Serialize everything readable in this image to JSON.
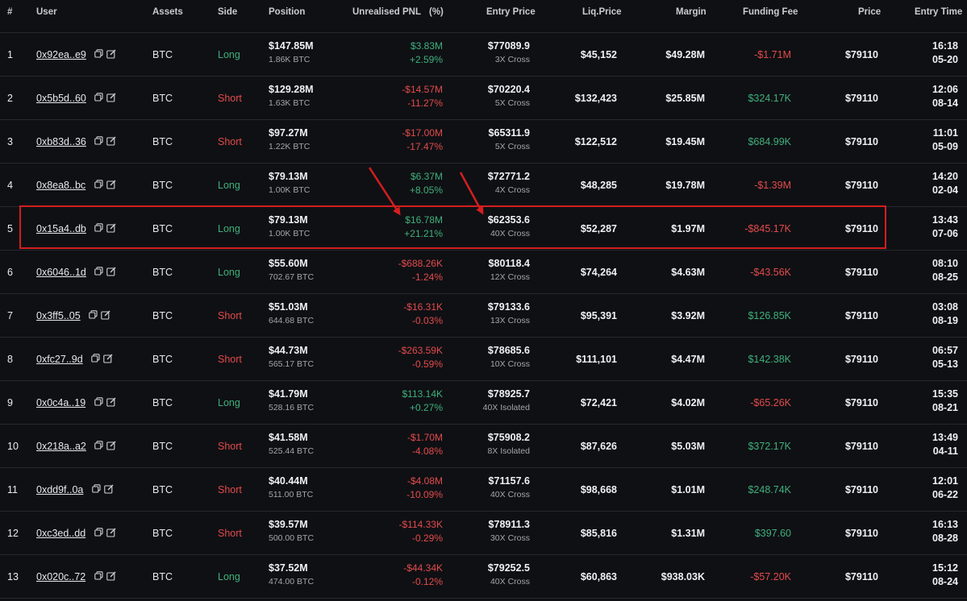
{
  "headers": {
    "rank": "#",
    "user": "User",
    "assets": "Assets",
    "side": "Side",
    "position": "Position",
    "pnl": "Unrealised PNL",
    "pct": "(%)",
    "entry": "Entry Price",
    "liq": "Liq.Price",
    "margin": "Margin",
    "funding": "Funding Fee",
    "price": "Price",
    "time": "Entry Time"
  },
  "colors": {
    "positive": "#3fb07c",
    "negative": "#e24b4b",
    "highlight": "#d41e1e"
  },
  "icons": [
    "copy-icon",
    "edit-icon"
  ],
  "rows": [
    {
      "rank": "1",
      "user": "0x92ea..e9",
      "asset": "BTC",
      "side": "Long",
      "sideType": "long",
      "position": "$147.85M",
      "positionBtc": "1.86K BTC",
      "pnl": "$3.83M",
      "pnlPct": "+2.59%",
      "pnlType": "pos",
      "entry": "$77089.9",
      "leverage": "3X Cross",
      "liq": "$45,152",
      "margin": "$49.28M",
      "funding": "-$1.71M",
      "fundingType": "neg",
      "price": "$79110",
      "time": "16:18",
      "date": "05-20"
    },
    {
      "rank": "2",
      "user": "0x5b5d..60",
      "asset": "BTC",
      "side": "Short",
      "sideType": "short",
      "position": "$129.28M",
      "positionBtc": "1.63K BTC",
      "pnl": "-$14.57M",
      "pnlPct": "-11.27%",
      "pnlType": "neg",
      "entry": "$70220.4",
      "leverage": "5X Cross",
      "liq": "$132,423",
      "margin": "$25.85M",
      "funding": "$324.17K",
      "fundingType": "pos",
      "price": "$79110",
      "time": "12:06",
      "date": "08-14"
    },
    {
      "rank": "3",
      "user": "0xb83d..36",
      "asset": "BTC",
      "side": "Short",
      "sideType": "short",
      "position": "$97.27M",
      "positionBtc": "1.22K BTC",
      "pnl": "-$17.00M",
      "pnlPct": "-17.47%",
      "pnlType": "neg",
      "entry": "$65311.9",
      "leverage": "5X Cross",
      "liq": "$122,512",
      "margin": "$19.45M",
      "funding": "$684.99K",
      "fundingType": "pos",
      "price": "$79110",
      "time": "11:01",
      "date": "05-09"
    },
    {
      "rank": "4",
      "user": "0x8ea8..bc",
      "asset": "BTC",
      "side": "Long",
      "sideType": "long",
      "position": "$79.13M",
      "positionBtc": "1.00K BTC",
      "pnl": "$6.37M",
      "pnlPct": "+8.05%",
      "pnlType": "pos",
      "entry": "$72771.2",
      "leverage": "4X Cross",
      "liq": "$48,285",
      "margin": "$19.78M",
      "funding": "-$1.39M",
      "fundingType": "neg",
      "price": "$79110",
      "time": "14:20",
      "date": "02-04"
    },
    {
      "rank": "5",
      "user": "0x15a4..db",
      "asset": "BTC",
      "side": "Long",
      "sideType": "long",
      "position": "$79.13M",
      "positionBtc": "1.00K BTC",
      "pnl": "$16.78M",
      "pnlPct": "+21.21%",
      "pnlType": "pos",
      "entry": "$62353.6",
      "leverage": "40X Cross",
      "liq": "$52,287",
      "margin": "$1.97M",
      "funding": "-$845.17K",
      "fundingType": "neg",
      "price": "$79110",
      "time": "13:43",
      "date": "07-06"
    },
    {
      "rank": "6",
      "user": "0x6046..1d",
      "asset": "BTC",
      "side": "Long",
      "sideType": "long",
      "position": "$55.60M",
      "positionBtc": "702.67 BTC",
      "pnl": "-$688.26K",
      "pnlPct": "-1.24%",
      "pnlType": "neg",
      "entry": "$80118.4",
      "leverage": "12X Cross",
      "liq": "$74,264",
      "margin": "$4.63M",
      "funding": "-$43.56K",
      "fundingType": "neg",
      "price": "$79110",
      "time": "08:10",
      "date": "08-25"
    },
    {
      "rank": "7",
      "user": "0x3ff5..05",
      "asset": "BTC",
      "side": "Short",
      "sideType": "short",
      "position": "$51.03M",
      "positionBtc": "644.68 BTC",
      "pnl": "-$16.31K",
      "pnlPct": "-0.03%",
      "pnlType": "neg",
      "entry": "$79133.6",
      "leverage": "13X Cross",
      "liq": "$95,391",
      "margin": "$3.92M",
      "funding": "$126.85K",
      "fundingType": "pos",
      "price": "$79110",
      "time": "03:08",
      "date": "08-19"
    },
    {
      "rank": "8",
      "user": "0xfc27..9d",
      "asset": "BTC",
      "side": "Short",
      "sideType": "short",
      "position": "$44.73M",
      "positionBtc": "565.17 BTC",
      "pnl": "-$263.59K",
      "pnlPct": "-0.59%",
      "pnlType": "neg",
      "entry": "$78685.6",
      "leverage": "10X Cross",
      "liq": "$111,101",
      "margin": "$4.47M",
      "funding": "$142.38K",
      "fundingType": "pos",
      "price": "$79110",
      "time": "06:57",
      "date": "05-13"
    },
    {
      "rank": "9",
      "user": "0x0c4a..19",
      "asset": "BTC",
      "side": "Long",
      "sideType": "long",
      "position": "$41.79M",
      "positionBtc": "528.16 BTC",
      "pnl": "$113.14K",
      "pnlPct": "+0.27%",
      "pnlType": "pos",
      "entry": "$78925.7",
      "leverage": "40X Isolated",
      "liq": "$72,421",
      "margin": "$4.02M",
      "funding": "-$65.26K",
      "fundingType": "neg",
      "price": "$79110",
      "time": "15:35",
      "date": "08-21"
    },
    {
      "rank": "10",
      "user": "0x218a..a2",
      "asset": "BTC",
      "side": "Short",
      "sideType": "short",
      "position": "$41.58M",
      "positionBtc": "525.44 BTC",
      "pnl": "-$1.70M",
      "pnlPct": "-4.08%",
      "pnlType": "neg",
      "entry": "$75908.2",
      "leverage": "8X Isolated",
      "liq": "$87,626",
      "margin": "$5.03M",
      "funding": "$372.17K",
      "fundingType": "pos",
      "price": "$79110",
      "time": "13:49",
      "date": "04-11"
    },
    {
      "rank": "11",
      "user": "0xdd9f..0a",
      "asset": "BTC",
      "side": "Short",
      "sideType": "short",
      "position": "$40.44M",
      "positionBtc": "511.00 BTC",
      "pnl": "-$4.08M",
      "pnlPct": "-10.09%",
      "pnlType": "neg",
      "entry": "$71157.6",
      "leverage": "40X Cross",
      "liq": "$98,668",
      "margin": "$1.01M",
      "funding": "$248.74K",
      "fundingType": "pos",
      "price": "$79110",
      "time": "12:01",
      "date": "06-22"
    },
    {
      "rank": "12",
      "user": "0xc3ed..dd",
      "asset": "BTC",
      "side": "Short",
      "sideType": "short",
      "position": "$39.57M",
      "positionBtc": "500.00 BTC",
      "pnl": "-$114.33K",
      "pnlPct": "-0.29%",
      "pnlType": "neg",
      "entry": "$78911.3",
      "leverage": "30X Cross",
      "liq": "$85,816",
      "margin": "$1.31M",
      "funding": "$397.60",
      "fundingType": "pos",
      "price": "$79110",
      "time": "16:13",
      "date": "08-28"
    },
    {
      "rank": "13",
      "user": "0x020c..72",
      "asset": "BTC",
      "side": "Long",
      "sideType": "long",
      "position": "$37.52M",
      "positionBtc": "474.00 BTC",
      "pnl": "-$44.34K",
      "pnlPct": "-0.12%",
      "pnlType": "neg",
      "entry": "$79252.5",
      "leverage": "40X Cross",
      "liq": "$60,863",
      "margin": "$938.03K",
      "funding": "-$57.20K",
      "fundingType": "neg",
      "price": "$79110",
      "time": "15:12",
      "date": "08-24"
    }
  ]
}
